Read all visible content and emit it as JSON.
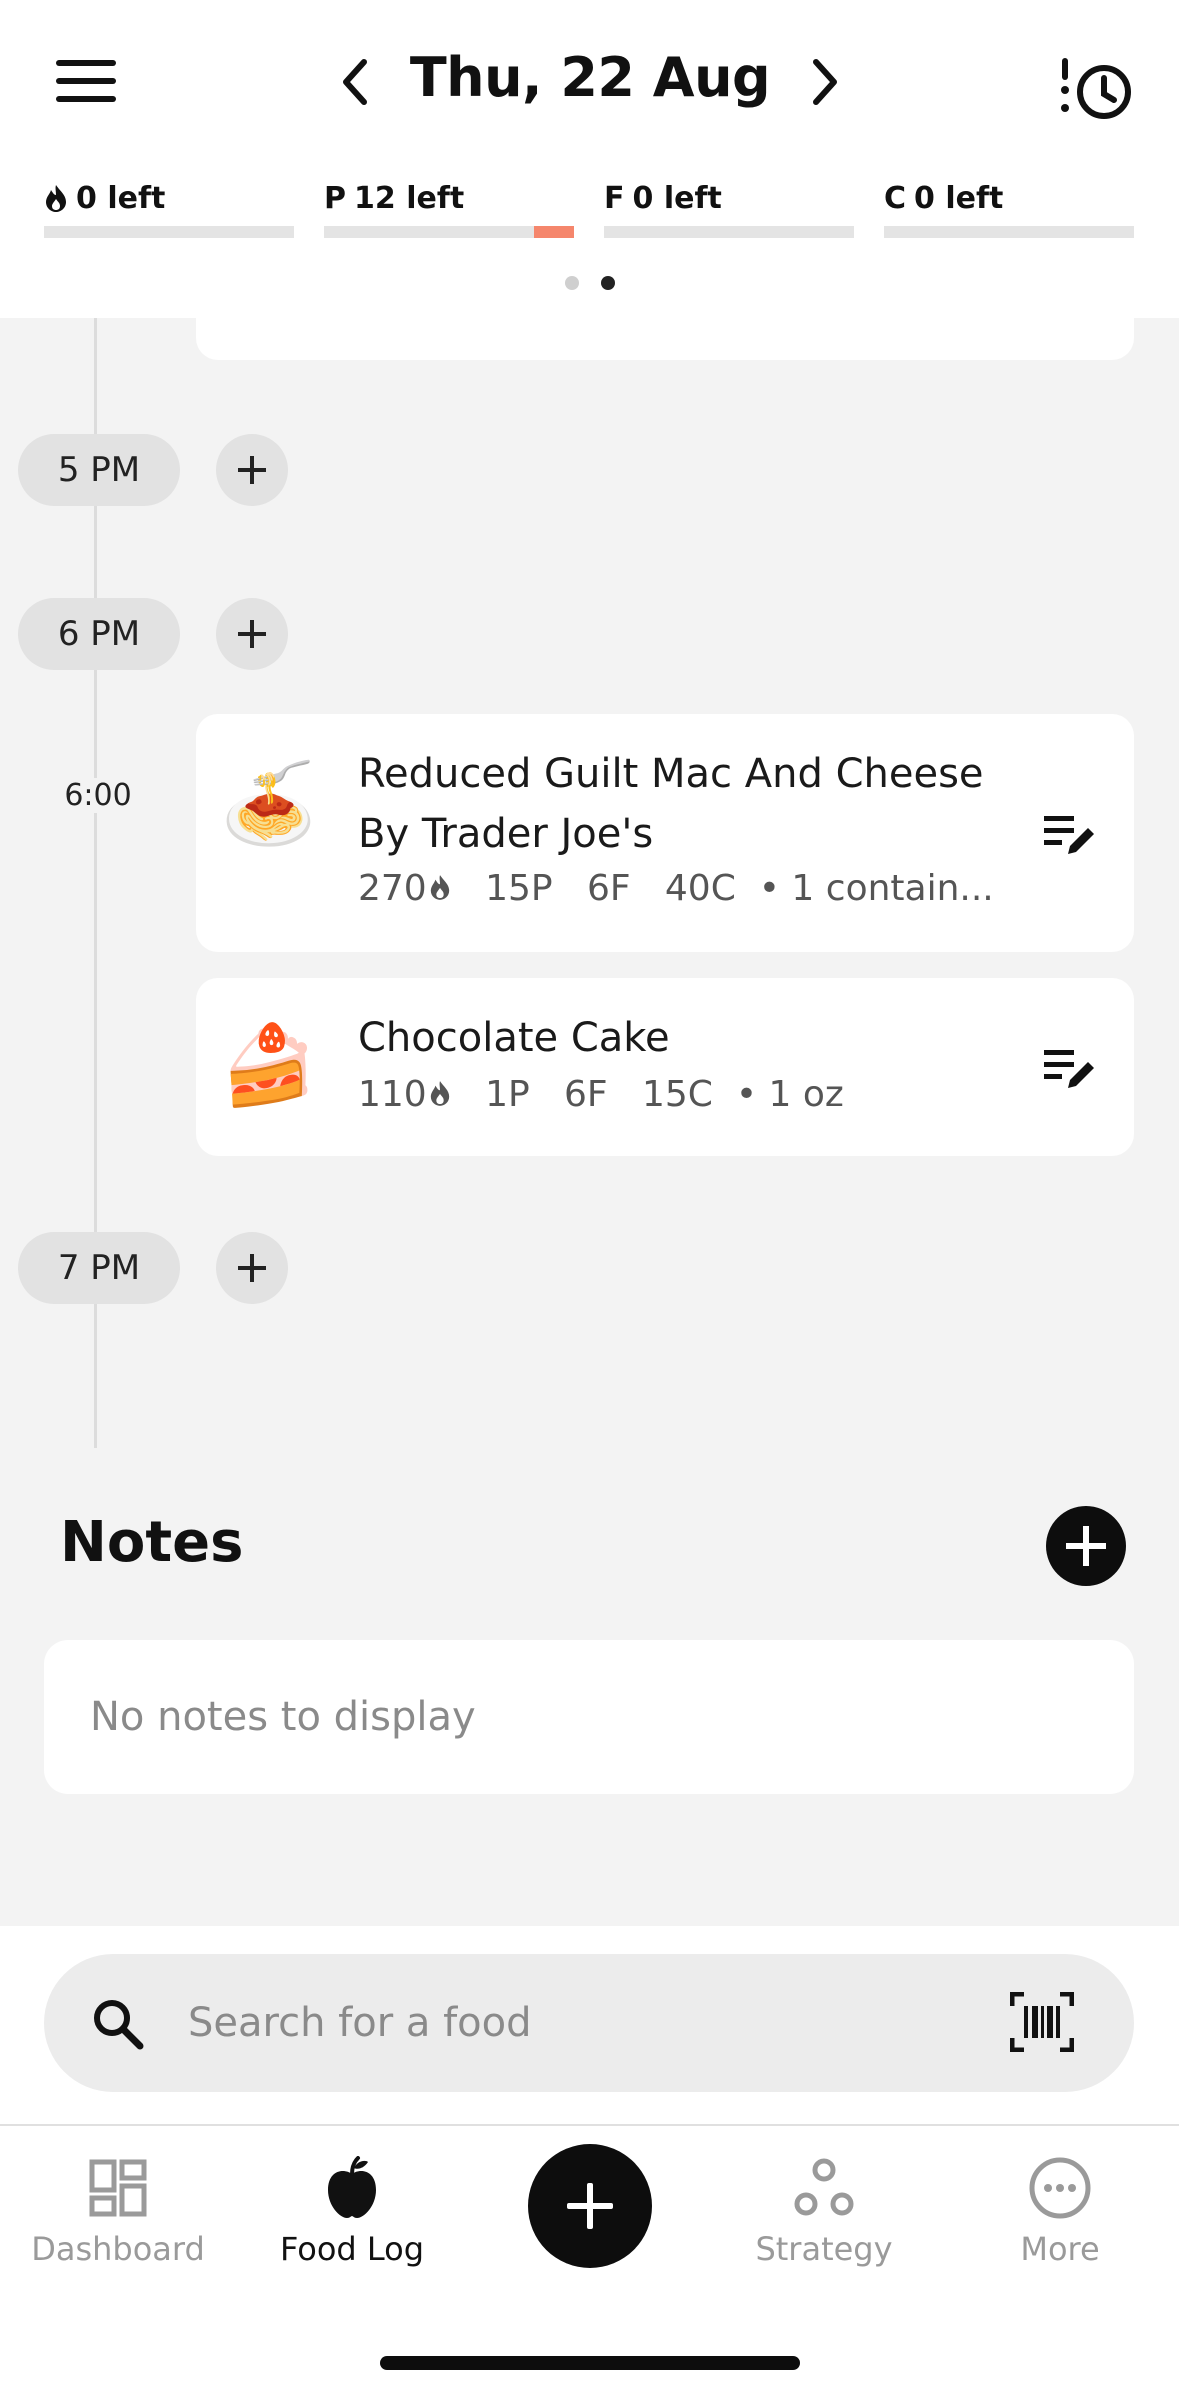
{
  "header": {
    "date_title": "Thu, 22 Aug",
    "icons": {
      "menu": "hamburger-menu-icon",
      "prev": "chevron-left-icon",
      "next": "chevron-right-icon",
      "history": "history-clock-icon"
    }
  },
  "macros": [
    {
      "letter": "",
      "icon": "flame-icon",
      "label": "0 left",
      "progress_over": 0
    },
    {
      "letter": "P",
      "label": "12 left",
      "progress_over": 0.16,
      "accent": "#f5866c"
    },
    {
      "letter": "F",
      "label": "0 left",
      "progress_over": 0
    },
    {
      "letter": "C",
      "label": "0 left",
      "progress_over": 0
    }
  ],
  "page_dots": {
    "count": 2,
    "active_index": 1
  },
  "timeline": {
    "hours": [
      "5 PM",
      "6 PM",
      "7 PM"
    ],
    "entry_time": "6:00",
    "foods": [
      {
        "emoji": "🍝",
        "name_line1": "Reduced Guilt Mac And Cheese",
        "name_line2": "By Trader Joe's",
        "calories": "270",
        "protein": "15P",
        "fat": "6F",
        "carbs": "40C",
        "serving": "• 1 contain..."
      },
      {
        "emoji": "🍰",
        "name_line1": "Chocolate Cake",
        "calories": "110",
        "protein": "1P",
        "fat": "6F",
        "carbs": "15C",
        "serving": "• 1 oz"
      }
    ]
  },
  "notes": {
    "title": "Notes",
    "empty_text": "No notes to display"
  },
  "search": {
    "placeholder": "Search for a food"
  },
  "nav": {
    "dashboard": "Dashboard",
    "food_log": "Food Log",
    "strategy": "Strategy",
    "more": "More",
    "active": "food_log"
  },
  "colors": {
    "accent_over": "#f5866c",
    "background": "#f3f3f3",
    "primary": "#0d0d0d"
  }
}
